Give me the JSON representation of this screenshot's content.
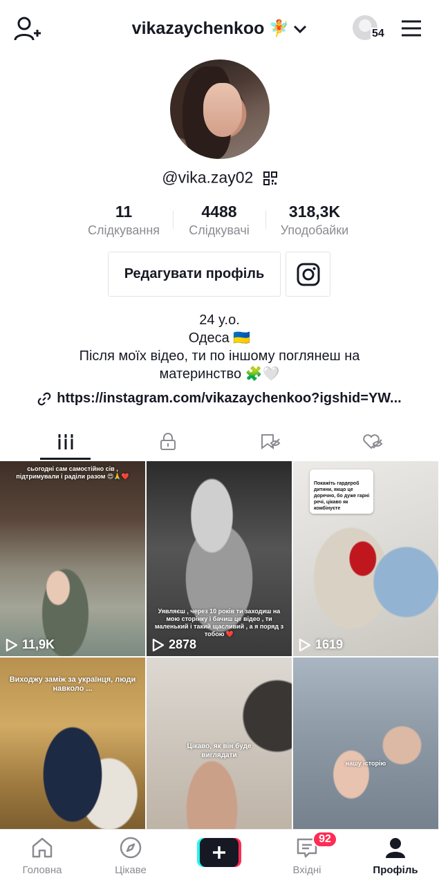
{
  "header": {
    "username": "vikazaychenkoo",
    "username_emoji": "🧚",
    "profile_views_count": "54",
    "add_friend_icon": "add-user-icon",
    "menu_icon": "hamburger-menu-icon"
  },
  "profile": {
    "handle": "@vika.zay02",
    "stats": [
      {
        "value": "11",
        "label": "Слідкування"
      },
      {
        "value": "4488",
        "label": "Слідкувачі"
      },
      {
        "value": "318,3K",
        "label": "Уподобайки"
      }
    ],
    "edit_button": "Редагувати профіль",
    "bio_lines": [
      "24 y.o.",
      "Одеса 🇺🇦",
      "Після моїх відео, ти по іншому поглянеш на",
      "материнство 🧩🤍"
    ],
    "link": "https://instagram.com/vikazaychenkoo?igshid=YW..."
  },
  "tabs": [
    {
      "icon": "grid-videos-icon",
      "active": true
    },
    {
      "icon": "private-lock-icon",
      "active": false
    },
    {
      "icon": "saved-hidden-icon",
      "active": false
    },
    {
      "icon": "liked-hidden-icon",
      "active": false
    }
  ],
  "videos": [
    {
      "views": "11,9K",
      "overlay": "сьогодні сам самостійно сів , підтримували і раділи разом 😍🙏❤️"
    },
    {
      "views": "2878",
      "overlay": "Уявляєш , через 10 років ти заходиш на мою сторінку і бачиш це відео , ти маленький і такий щасливий , а я поряд з тобою ❤️"
    },
    {
      "views": "1619",
      "overlay": "Покажіть гардероб дитини, якщо це доречно, бо дуже гарні речі, цікаво як комбінуєте"
    },
    {
      "views": "",
      "overlay": "Виходжу заміж за українця, люди навколо ..."
    },
    {
      "views": "",
      "overlay": "Цікаво, як він буде виглядати"
    },
    {
      "views": "",
      "overlay": "нашу історію"
    }
  ],
  "bottom_nav": [
    {
      "label": "Головна",
      "icon": "home-icon"
    },
    {
      "label": "Цікаве",
      "icon": "compass-icon"
    },
    {
      "label": "",
      "icon": "create-plus-icon"
    },
    {
      "label": "Вхідні",
      "icon": "inbox-icon",
      "badge": "92"
    },
    {
      "label": "Профіль",
      "icon": "profile-icon",
      "active": true
    }
  ],
  "colors": {
    "accent": "#fe2c55",
    "cyan": "#25f4ee",
    "text": "#161823",
    "muted": "#8a8b91"
  }
}
